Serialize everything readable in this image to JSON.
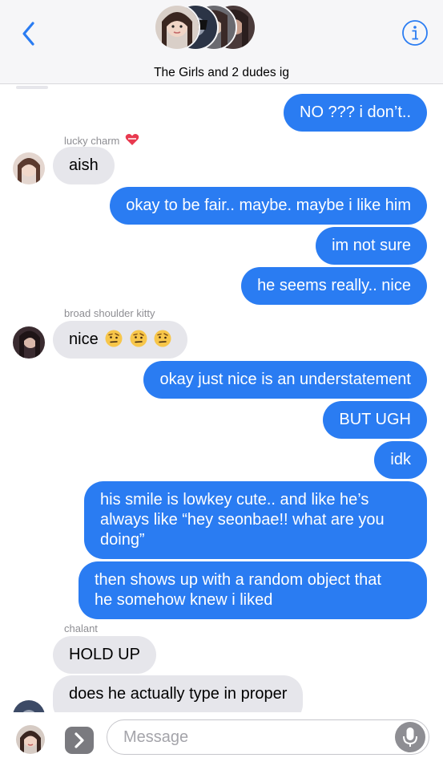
{
  "header": {
    "title": "The Girls and 2 dudes ig"
  },
  "messages": [
    {
      "from": "me",
      "text": "NO ??? i don’t.."
    },
    {
      "sender": "lucky charm",
      "from": "them",
      "text": "aish"
    },
    {
      "from": "me",
      "text": "okay to be fair.. maybe. maybe i like him"
    },
    {
      "from": "me",
      "text": "im not sure"
    },
    {
      "from": "me",
      "text": "he seems really.. nice"
    },
    {
      "sender": "broad shoulder kitty",
      "from": "them",
      "text": "nice"
    },
    {
      "from": "me",
      "text": "okay just nice is an understatement"
    },
    {
      "from": "me",
      "text": "BUT UGH"
    },
    {
      "from": "me",
      "text": "idk"
    },
    {
      "from": "me",
      "lines": [
        "his smile is lowkey cute.. and like he’s",
        "always like “hey seonbae!! what are you",
        "doing”"
      ]
    },
    {
      "from": "me",
      "lines": [
        "then shows up with a random object that",
        "he somehow knew i liked"
      ]
    },
    {
      "sender": "chalant",
      "from": "them",
      "text": "HOLD UP"
    },
    {
      "from": "them",
      "text": "does he actually type in proper"
    }
  ],
  "composer": {
    "placeholder": "Message"
  },
  "colors": {
    "sent_bubble": "#2a7cf2",
    "received_bubble": "#e6e6eb",
    "accent": "#2a7cf2"
  },
  "icons": {
    "back": "chevron-left-icon",
    "info": "info-icon",
    "apps": "chevron-right-icon",
    "mic": "mic-icon",
    "heart": "heart-icon",
    "emoji": "raised-eyebrow-face-icon"
  }
}
